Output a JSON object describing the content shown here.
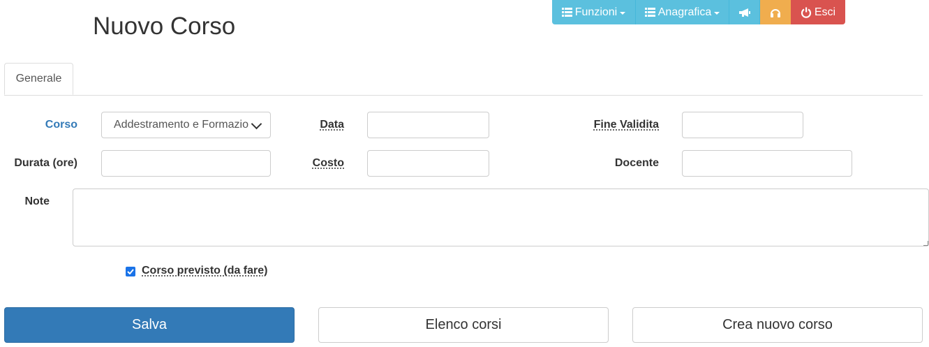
{
  "page": {
    "title": "Nuovo Corso"
  },
  "nav": {
    "funzioni": "Funzioni",
    "anagrafica": "Anagrafica",
    "esci": "Esci",
    "icons": {
      "list": "list-icon",
      "megaphone": "megaphone-icon",
      "headphones": "headphones-icon",
      "power": "power-icon"
    },
    "colors": {
      "info": "#5bc0de",
      "warning": "#f0ad4e",
      "danger": "#d9534f"
    }
  },
  "tabs": [
    {
      "label": "Generale",
      "active": true
    }
  ],
  "form": {
    "corso": {
      "label": "Corso",
      "value": "Addestramento e Formazione"
    },
    "data": {
      "label": "Data",
      "value": ""
    },
    "fine_validita": {
      "label": "Fine Validita",
      "value": ""
    },
    "durata": {
      "label": "Durata (ore)",
      "value": ""
    },
    "costo": {
      "label": "Costo",
      "value": ""
    },
    "docente": {
      "label": "Docente",
      "value": ""
    },
    "note": {
      "label": "Note",
      "value": ""
    },
    "previsto": {
      "label": "Corso previsto (da fare)",
      "checked": true
    }
  },
  "actions": {
    "salva": "Salva",
    "elenco": "Elenco corsi",
    "crea": "Crea nuovo corso",
    "primary_color": "#337ab7"
  }
}
